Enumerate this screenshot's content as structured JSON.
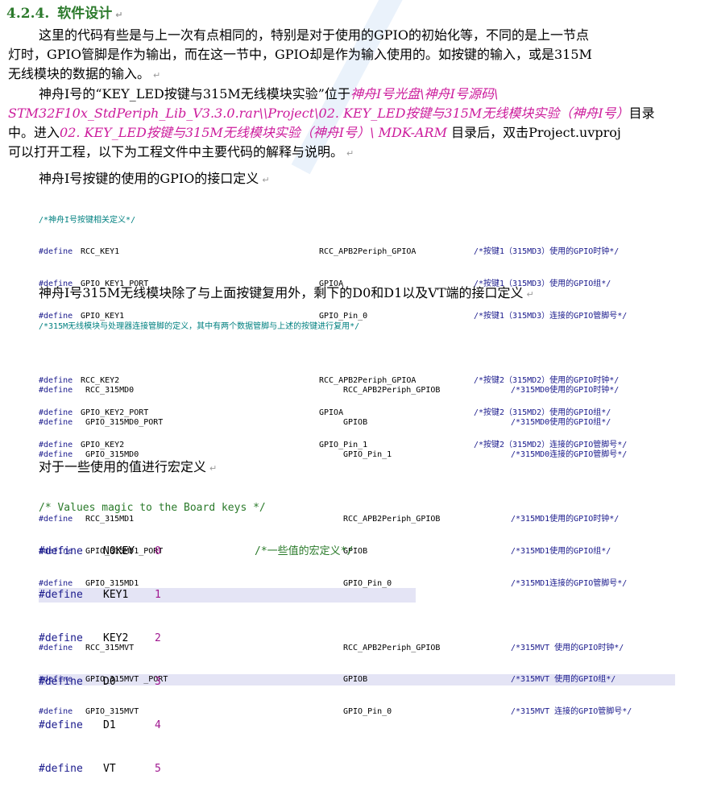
{
  "heading": {
    "number": "4.2.4.",
    "title": "软件设计"
  },
  "paragraph1": [
    "这里的代码有些是与上一次有点相同的，特别是对于使用的GPIO的初始化等，不同的是上一节点",
    "灯时，GPIO管脚是作为输出，而在这一节中，GPIO却是作为输入使用的。如按键的输入，或是315M",
    "无线模块的数据的输入。"
  ],
  "paragraph2": {
    "line1_a": "神舟I号的“KEY_LED按键与315M无线模块实验”位于",
    "line1_b": "神舟I号光盘\\神舟I号源码\\",
    "line2_a": "STM32F10x_StdPeriph_Lib_V3.3.0.rar\\\\Project\\02. KEY_LED按键与315M无线模块实验（神舟I号）",
    "line2_b": "目录",
    "line3_a": "中。进入",
    "line3_b": "02. KEY_LED按键与315M无线模块实验（神舟I号）\\ MDK-ARM",
    "line3_c": " 目录后，双击Project.uvproj",
    "line4": "可以打开工程，以下为工程文件中主要代码的解释与说明。"
  },
  "subtitle1": "神舟I号按键的使用的GPIO的接口定义",
  "code1": {
    "comment": "/*神舟I号按键相关定义*/",
    "group1": [
      {
        "kw": "#define",
        "name": "RCC_KEY1",
        "value": "RCC_APB2Periph_GPIOA",
        "comment": "/*按键1（315MD3）使用的GPIO时钟*/"
      },
      {
        "kw": "#define",
        "name": "GPIO_KEY1_PORT",
        "value": "GPIOA",
        "comment": "/*按键1（315MD3）使用的GPIO组*/"
      },
      {
        "kw": "#define",
        "name": "GPIO_KEY1",
        "value": "GPIO_Pin_0",
        "comment": "/*按键1（315MD3）连接的GPIO管脚号*/"
      }
    ],
    "group2": [
      {
        "kw": "#define",
        "name": "RCC_KEY2",
        "value": "RCC_APB2Periph_GPIOA",
        "comment": "/*按键2（315MD2）使用的GPIO时钟*/"
      },
      {
        "kw": "#define",
        "name": "GPIO_KEY2_PORT",
        "value": "GPIOA",
        "comment": "/*按键2（315MD2）使用的GPIO组*/"
      },
      {
        "kw": "#define",
        "name": "GPIO_KEY2",
        "value": "GPIO_Pin_1",
        "comment": "/*按键2（315MD2）连接的GPIO管脚号*/"
      }
    ]
  },
  "subtitle2": "神舟I号315M无线模块除了与上面按键复用外，剩下的D0和D1以及VT端的接口定义",
  "code2": {
    "comment": "/*315M无线模块与处理器连接管脚的定义，其中有两个数据管脚与上述的按键进行复用*/",
    "group1": [
      {
        "kw": "#define",
        "name": "RCC_315MD0",
        "value": "RCC_APB2Periph_GPIOB",
        "comment": "/*315MD0使用的GPIO时钟*/"
      },
      {
        "kw": "#define",
        "name": "GPIO_315MD0_PORT",
        "value": "GPIOB",
        "comment": "/*315MD0使用的GPIO组*/"
      },
      {
        "kw": "#define",
        "name": "GPIO_315MD0",
        "value": "GPIO_Pin_1",
        "comment": "/*315MD0连接的GPIO管脚号*/"
      }
    ],
    "group2": [
      {
        "kw": "#define",
        "name": "RCC_315MD1",
        "value": "RCC_APB2Periph_GPIOB",
        "comment": "/*315MD1使用的GPIO时钟*/"
      },
      {
        "kw": "#define",
        "name": "GPIO_315MD1_PORT",
        "value": "GPIOB",
        "comment": "/*315MD1使用的GPIO组*/"
      },
      {
        "kw": "#define",
        "name": "GPIO_315MD1",
        "value": "GPIO_Pin_0",
        "comment": "/*315MD1连接的GPIO管脚号*/"
      }
    ],
    "group3": [
      {
        "kw": "#define",
        "name": "RCC_315MVT",
        "value": "RCC_APB2Periph_GPIOB",
        "comment": "/*315MVT 使用的GPIO时钟*/"
      },
      {
        "kw": "#define",
        "name": "GPIO_315MVT _PORT",
        "value": "GPIOB",
        "comment": "/*315MVT 使用的GPIO组*/"
      },
      {
        "kw": "#define",
        "name": "GPIO_315MVT",
        "value": "GPIO_Pin_0",
        "comment": "/*315MVT 连接的GPIO管脚号*/"
      }
    ]
  },
  "subtitle3": "对于一些使用的值进行宏定义",
  "code3": {
    "comment": "/* Values magic to the Board keys */",
    "inline_comment": "/*一些值的宏定义*/",
    "rows": [
      {
        "kw": "#define",
        "name": "NOKEY",
        "value": "0"
      },
      {
        "kw": "#define",
        "name": "KEY1",
        "value": "1"
      },
      {
        "kw": "#define",
        "name": "KEY2",
        "value": "2"
      },
      {
        "kw": "#define",
        "name": "D0",
        "value": "3"
      },
      {
        "kw": "#define",
        "name": "D1",
        "value": "4"
      },
      {
        "kw": "#define",
        "name": "VT",
        "value": "5"
      }
    ]
  },
  "return_mark": "↵"
}
